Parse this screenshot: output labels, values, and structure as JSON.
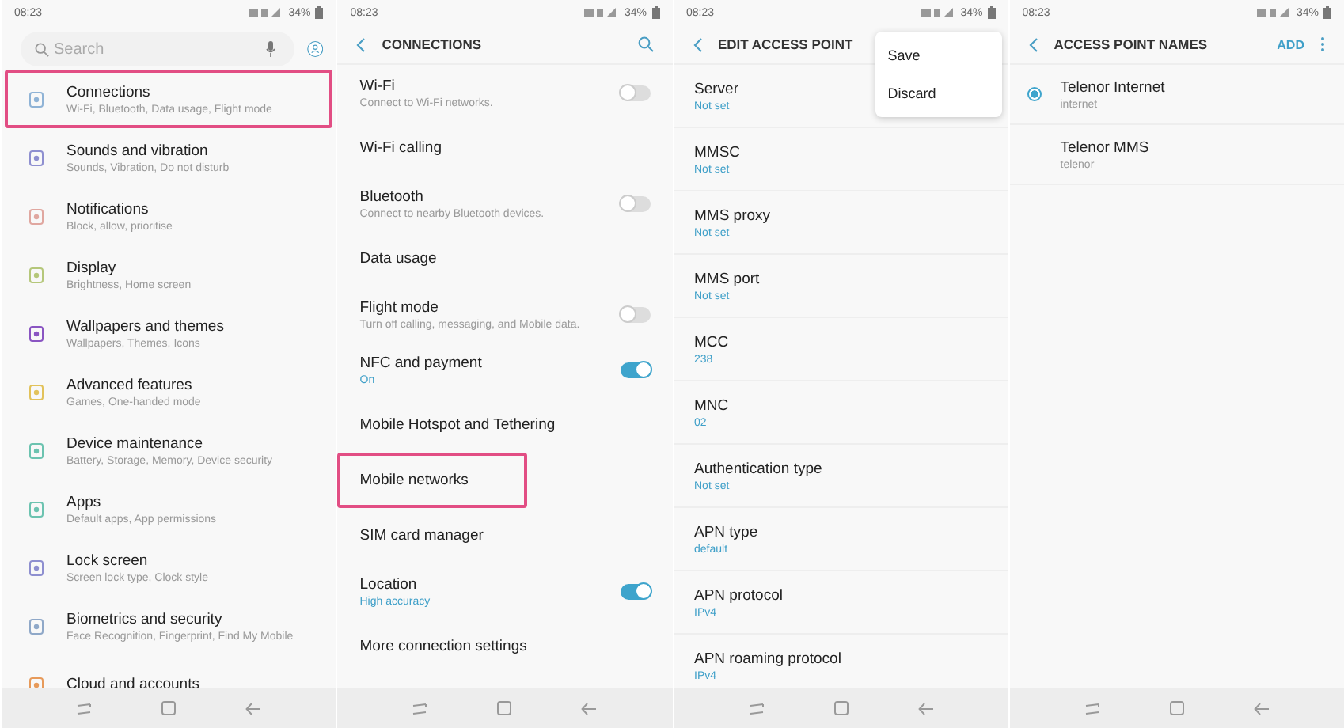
{
  "panels": [
    {
      "kind": "settings",
      "status": {
        "time": "08:23",
        "battery": "34%"
      },
      "search": {
        "placeholder": "Search"
      },
      "items": [
        {
          "title": "Connections",
          "subtitle": "Wi-Fi, Bluetooth, Data usage, Flight mode",
          "highlighted": true
        },
        {
          "title": "Sounds and vibration",
          "subtitle": "Sounds, Vibration, Do not disturb",
          "highlighted": false
        },
        {
          "title": "Notifications",
          "subtitle": "Block, allow, prioritise",
          "highlighted": false
        },
        {
          "title": "Display",
          "subtitle": "Brightness, Home screen",
          "highlighted": false
        },
        {
          "title": "Wallpapers and themes",
          "subtitle": "Wallpapers, Themes, Icons",
          "highlighted": false
        },
        {
          "title": "Advanced features",
          "subtitle": "Games, One-handed mode",
          "highlighted": false
        },
        {
          "title": "Device maintenance",
          "subtitle": "Battery, Storage, Memory, Device security",
          "highlighted": false
        },
        {
          "title": "Apps",
          "subtitle": "Default apps, App permissions",
          "highlighted": false
        },
        {
          "title": "Lock screen",
          "subtitle": "Screen lock type, Clock style",
          "highlighted": false
        },
        {
          "title": "Biometrics and security",
          "subtitle": "Face Recognition, Fingerprint, Find My Mobile",
          "highlighted": false
        },
        {
          "title": "Cloud and accounts",
          "highlighted": false
        }
      ]
    },
    {
      "kind": "connections",
      "status": {
        "time": "08:23",
        "battery": "34%"
      },
      "header": {
        "title": "CONNECTIONS"
      },
      "items": [
        {
          "kind": "switch",
          "title": "Wi-Fi",
          "subtitle": "Connect to Wi-Fi networks.",
          "on": false,
          "highlighted": false
        },
        {
          "kind": "plain",
          "title": "Wi-Fi calling",
          "highlighted": false
        },
        {
          "kind": "switch",
          "title": "Bluetooth",
          "subtitle": "Connect to nearby Bluetooth devices.",
          "on": false,
          "highlighted": false
        },
        {
          "kind": "plain",
          "title": "Data usage",
          "highlighted": false
        },
        {
          "kind": "switch",
          "title": "Flight mode",
          "subtitle": "Turn off calling, messaging, and Mobile data.",
          "on": false,
          "highlighted": false
        },
        {
          "kind": "switch",
          "title": "NFC and payment",
          "subtitle": "On",
          "on": true,
          "highlighted": false
        },
        {
          "kind": "plain",
          "title": "Mobile Hotspot and Tethering",
          "highlighted": false
        },
        {
          "kind": "plain",
          "title": "Mobile networks",
          "highlighted": true
        },
        {
          "kind": "plain",
          "title": "SIM card manager",
          "highlighted": false
        },
        {
          "kind": "switch",
          "title": "Location",
          "subtitle": "High accuracy",
          "on": true,
          "highlighted": false
        },
        {
          "kind": "plain",
          "title": "More connection settings",
          "highlighted": false
        }
      ]
    },
    {
      "kind": "form",
      "status": {
        "time": "08:23",
        "battery": "34%"
      },
      "header": {
        "title": "EDIT ACCESS POINT"
      },
      "menu": [
        "Save",
        "Discard"
      ],
      "fields": [
        {
          "label": "Server",
          "value": "Not set"
        },
        {
          "label": "MMSC",
          "value": "Not set"
        },
        {
          "label": "MMS proxy",
          "value": "Not set"
        },
        {
          "label": "MMS port",
          "value": "Not set"
        },
        {
          "label": "MCC",
          "value": "238"
        },
        {
          "label": "MNC",
          "value": "02"
        },
        {
          "label": "Authentication type",
          "value": "Not set"
        },
        {
          "label": "APN type",
          "value": "default"
        },
        {
          "label": "APN protocol",
          "value": "IPv4"
        },
        {
          "label": "APN roaming protocol",
          "value": "IPv4"
        }
      ]
    },
    {
      "kind": "apn_list",
      "status": {
        "time": "08:23",
        "battery": "34%"
      },
      "header": {
        "title": "ACCESS POINT NAMES",
        "action": "ADD"
      },
      "items": [
        {
          "title": "Telenor Internet",
          "subtitle": "internet",
          "selected": true
        },
        {
          "title": "Telenor MMS",
          "subtitle": "telenor",
          "selected": false
        }
      ]
    }
  ]
}
